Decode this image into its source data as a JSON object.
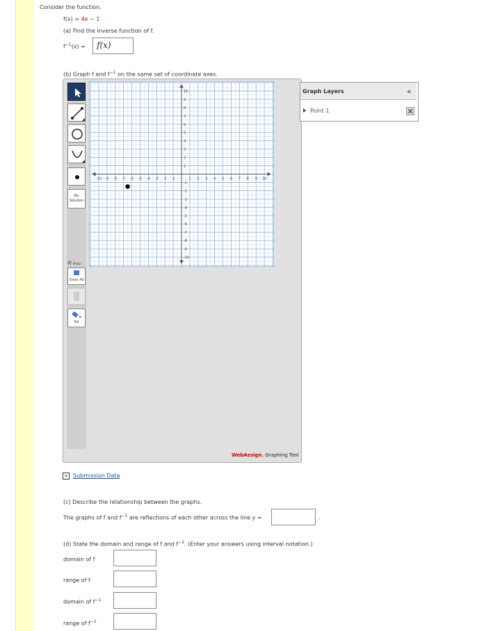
{
  "intro": "Consider the function.",
  "function_def": {
    "lhs": "f(x) = ",
    "rhs": "4x − 1"
  },
  "part_a": {
    "prompt": "(a) Find the inverse function of f.",
    "lhs": "f",
    "sup": "−1",
    "lhs2": "(x) = ",
    "answer": "f(x)"
  },
  "part_b": {
    "prompt_start": "(b) Graph f and f",
    "sup": "−1",
    "prompt_end": " on the same set of coordinate axes."
  },
  "toolbar": {
    "no_solution_line1": "No",
    "no_solution_line2": "Solution",
    "help": "Help",
    "clear_all": "Clear All",
    "fill": "Fill"
  },
  "graph": {
    "x_min": -10,
    "x_max": 10,
    "y_min": -10,
    "y_max": 10,
    "x_ticks": [
      "-10",
      "-9",
      "-8",
      "-7",
      "-6",
      "-5",
      "-4",
      "-3",
      "-2",
      "-1",
      "1",
      "2",
      "3",
      "4",
      "5",
      "6",
      "7",
      "8",
      "9",
      "10"
    ],
    "y_ticks": [
      "10",
      "9",
      "8",
      "7",
      "6",
      "5",
      "4",
      "3",
      "2",
      "1",
      "-1",
      "-2",
      "-3",
      "-4",
      "-5",
      "-6",
      "-7",
      "-8",
      "-9",
      "-10"
    ],
    "plotted_point": {
      "x": -6.5,
      "y": -1.5
    },
    "brand": "WebAssign.",
    "brand_suffix": " Graphing Tool",
    "brand_color": "#cc0000"
  },
  "layers": {
    "title": "Graph Layers",
    "collapse": "«",
    "items": [
      "Point 1"
    ]
  },
  "submission": {
    "toggle": "+",
    "label": "Submission Data"
  },
  "part_c": {
    "prompt": "(c) Describe the relationship between the graphs.",
    "sentence_start": "The graphs of f and f",
    "sup": "−1",
    "sentence_end": " are reflections of each other across the line ",
    "var": "y = ",
    "value": "",
    "period": "."
  },
  "part_d": {
    "prompt_start": "(d) State the domain and range of f and f",
    "sup": "−1",
    "prompt_end": ". (Enter your answers using interval notation.)",
    "fields": [
      {
        "label": "domain of f",
        "sup": "",
        "value": ""
      },
      {
        "label": "range of f",
        "sup": "",
        "value": ""
      },
      {
        "label": "domain of f",
        "sup": "−1",
        "value": ""
      },
      {
        "label": "range of f",
        "sup": "−1",
        "value": ""
      }
    ]
  }
}
